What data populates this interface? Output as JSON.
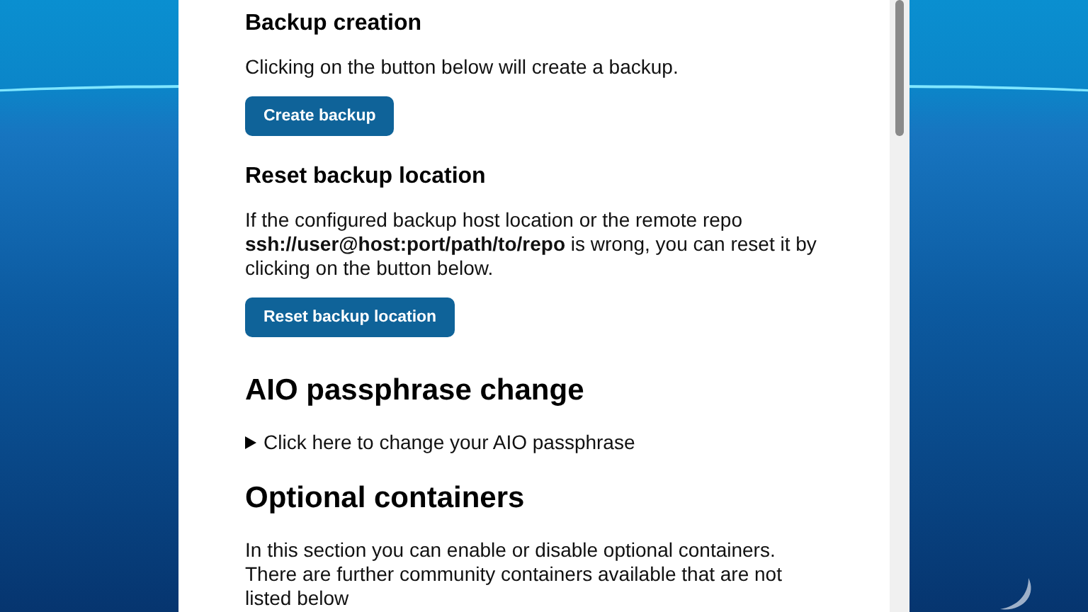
{
  "sections": [
    {
      "kind": "h3",
      "title": "Backup creation",
      "text": "Clicking on the button below will create a backup.",
      "button": "Create backup"
    },
    {
      "kind": "h3",
      "title": "Reset backup location",
      "text": "If the configured backup host location or the remote repo **ssh://user@host:port/path/to/repo** is wrong, you can reset it by clicking on the button below.",
      "button": "Reset backup location"
    },
    {
      "kind": "h2",
      "title": "AIO passphrase change",
      "summary": "Click here to change your AIO passphrase",
      "expanded": false
    },
    {
      "kind": "h2",
      "title": "Optional containers",
      "text": "In this section you can enable or disable optional containers. There are further community containers available that are not listed below"
    }
  ]
}
